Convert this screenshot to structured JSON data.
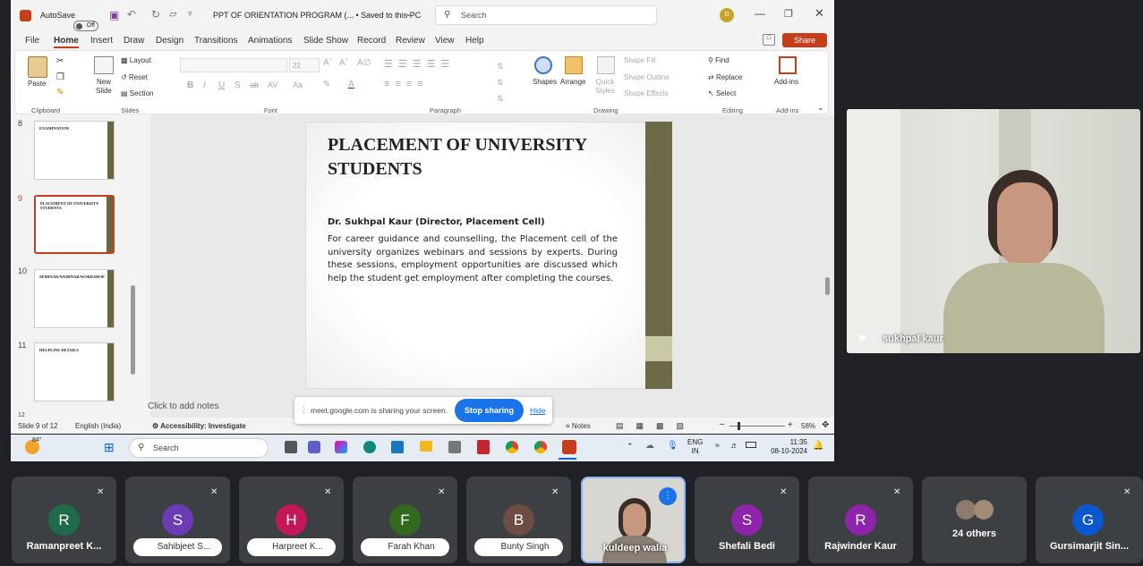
{
  "ppt": {
    "autosave_label": "AutoSave",
    "autosave_state": "Off",
    "doc_title": "PPT OF ORIENTATION PROGRAM (... • Saved to this PC",
    "search_placeholder": "Search",
    "user_initial": "D",
    "menu": [
      "File",
      "Home",
      "Insert",
      "Draw",
      "Design",
      "Transitions",
      "Animations",
      "Slide Show",
      "Record",
      "Review",
      "View",
      "Help"
    ],
    "share_label": "Share",
    "ribbon": {
      "paste": "Paste",
      "clipboard": "Clipboard",
      "new_slide": "New Slide",
      "layout": "Layout",
      "reset": "Reset",
      "section": "Section",
      "slides": "Slides",
      "font_size": "22",
      "font": "Font",
      "paragraph": "Paragraph",
      "shapes": "Shapes",
      "arrange": "Arrange",
      "quick_styles": "Quick Styles",
      "shape_fill": "Shape Fill",
      "shape_outline": "Shape Outline",
      "shape_effects": "Shape Effects",
      "drawing": "Drawing",
      "find": "Find",
      "replace": "Replace",
      "select": "Select",
      "editing": "Editing",
      "addins": "Add-ins",
      "addins_group": "Add-ins"
    },
    "thumbs": [
      {
        "num": "8",
        "title": "EXAMINATION"
      },
      {
        "num": "9",
        "title": "PLACEMENT OF UNIVERSITY STUDENTS"
      },
      {
        "num": "10",
        "title": "SEMINAR/WEBINAR/WORKSHOP"
      },
      {
        "num": "11",
        "title": "HELPLINE DETAILS"
      }
    ],
    "thumb_partial_num": "12",
    "slide": {
      "title": "PLACEMENT OF UNIVERSITY STUDENTS",
      "author": "Dr. Sukhpal Kaur (Director, Placement Cell)",
      "body": "For career guidance and counselling, the Placement cell of the university organizes webinars and sessions by experts. During these sessions, employment opportunities are discussed which help the student get employment after completing the courses."
    },
    "notes_placeholder": "Click to add notes",
    "status": {
      "slide": "Slide 9 of 12",
      "lang": "English (India)",
      "accessibility": "Accessibility: Investigate",
      "notes": "Notes",
      "zoom": "58%"
    },
    "share_bar": {
      "text": "meet.google.com is sharing your screen.",
      "stop": "Stop sharing",
      "hide": "Hide"
    }
  },
  "taskbar": {
    "temp": "84°",
    "search": "Search",
    "lang": "ENG",
    "region": "IN",
    "time": "11:35",
    "date": "08-10-2024"
  },
  "presenter": {
    "name": "sukhpal kaur"
  },
  "tiles": [
    {
      "initial": "R",
      "name": "Ramanpreet K...",
      "color": "#1e6b4a",
      "muted": true,
      "chip": false
    },
    {
      "initial": "S",
      "name": "Sahibjeet S...",
      "color": "#6a3bb5",
      "muted": true,
      "chip": true
    },
    {
      "initial": "H",
      "name": "Harpreet K...",
      "color": "#c2185b",
      "muted": true,
      "chip": true
    },
    {
      "initial": "F",
      "name": "Farah Khan",
      "color": "#33691e",
      "muted": true,
      "chip": true
    },
    {
      "initial": "B",
      "name": "Bunty Singh",
      "color": "#6d4c41",
      "muted": true,
      "chip": true
    },
    {
      "initial": "",
      "name": "kuldeep walia",
      "color": "",
      "muted": false,
      "chip": false
    },
    {
      "initial": "S",
      "name": "Shefali Bedi",
      "color": "#8e24aa",
      "muted": true,
      "chip": false
    },
    {
      "initial": "R",
      "name": "Rajwinder Kaur",
      "color": "#8e24aa",
      "muted": true,
      "chip": false
    },
    {
      "initial": "",
      "name": "24 others",
      "color": "",
      "muted": false,
      "chip": false
    },
    {
      "initial": "G",
      "name": "Gursimarjit Sin...",
      "color": "#0b57d0",
      "muted": true,
      "chip": false
    }
  ]
}
